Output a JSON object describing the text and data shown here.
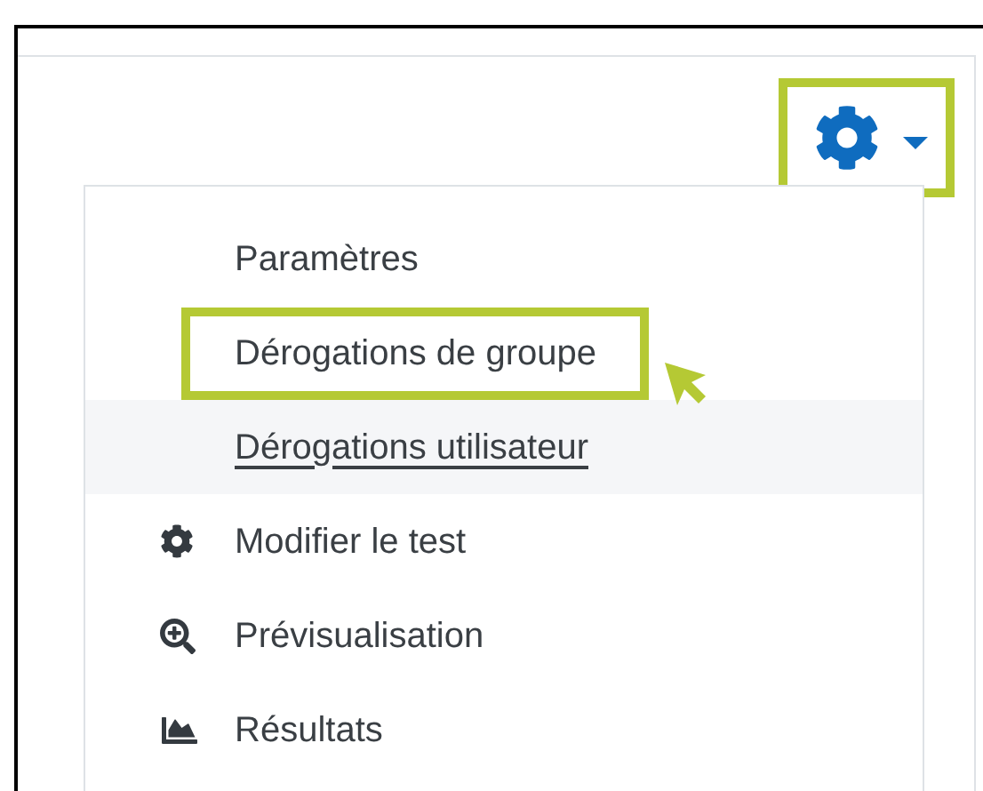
{
  "settings_button": {
    "highlighted": true
  },
  "menu": {
    "items": [
      {
        "label": "Paramètres",
        "kind": "text",
        "highlighted": false,
        "hovered": false
      },
      {
        "label": "Dérogations de groupe",
        "kind": "text",
        "highlighted": true,
        "hovered": false
      },
      {
        "label": "Dérogations utilisateur",
        "kind": "text",
        "highlighted": false,
        "hovered": true
      },
      {
        "label": "Modifier le test",
        "kind": "gear",
        "highlighted": false,
        "hovered": false
      },
      {
        "label": "Prévisualisation",
        "kind": "zoom",
        "highlighted": false,
        "hovered": false
      },
      {
        "label": "Résultats",
        "kind": "chart",
        "highlighted": false,
        "hovered": false
      }
    ]
  }
}
